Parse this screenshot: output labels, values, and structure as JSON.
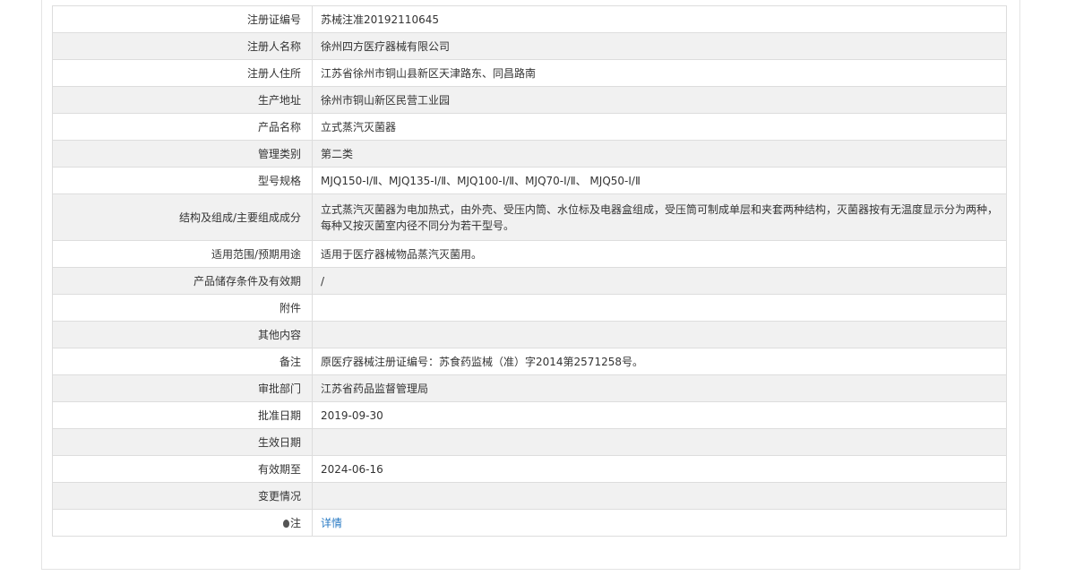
{
  "rows": [
    {
      "label": "注册证编号",
      "value": "苏械注准20192110645"
    },
    {
      "label": "注册人名称",
      "value": "徐州四方医疗器械有限公司"
    },
    {
      "label": "注册人住所",
      "value": "江苏省徐州市铜山县新区天津路东、同昌路南"
    },
    {
      "label": "生产地址",
      "value": "徐州市铜山新区民营工业园"
    },
    {
      "label": "产品名称",
      "value": "立式蒸汽灭菌器"
    },
    {
      "label": "管理类别",
      "value": "第二类"
    },
    {
      "label": "型号规格",
      "value": "MJQ150-Ⅰ/Ⅱ、MJQ135-Ⅰ/Ⅱ、MJQ100-Ⅰ/Ⅱ、MJQ70-Ⅰ/Ⅱ、 MJQ50-Ⅰ/Ⅱ"
    },
    {
      "label": "结构及组成/主要组成成分",
      "value": "立式蒸汽灭菌器为电加热式，由外壳、受压内筒、水位标及电器盒组成，受压筒可制成单层和夹套两种结构，灭菌器按有无温度显示分为两种，每种又按灭菌室内径不同分为若干型号。"
    },
    {
      "label": "适用范围/预期用途",
      "value": "适用于医疗器械物品蒸汽灭菌用。"
    },
    {
      "label": "产品储存条件及有效期",
      "value": "/"
    },
    {
      "label": "附件",
      "value": ""
    },
    {
      "label": "其他内容",
      "value": ""
    },
    {
      "label": "备注",
      "value": "原医疗器械注册证编号：苏食药监械（准）字2014第2571258号。"
    },
    {
      "label": "审批部门",
      "value": "江苏省药品监督管理局"
    },
    {
      "label": "批准日期",
      "value": "2019-09-30"
    },
    {
      "label": "生效日期",
      "value": ""
    },
    {
      "label": "有效期至",
      "value": "2024-06-16"
    },
    {
      "label": "变更情况",
      "value": ""
    }
  ],
  "note_row": {
    "label": "注",
    "icon": "bulb-icon",
    "link_text": "详情"
  },
  "colors": {
    "link": "#2a7bc4",
    "row_alt": "#f1f1f1",
    "border": "#dddddd"
  }
}
